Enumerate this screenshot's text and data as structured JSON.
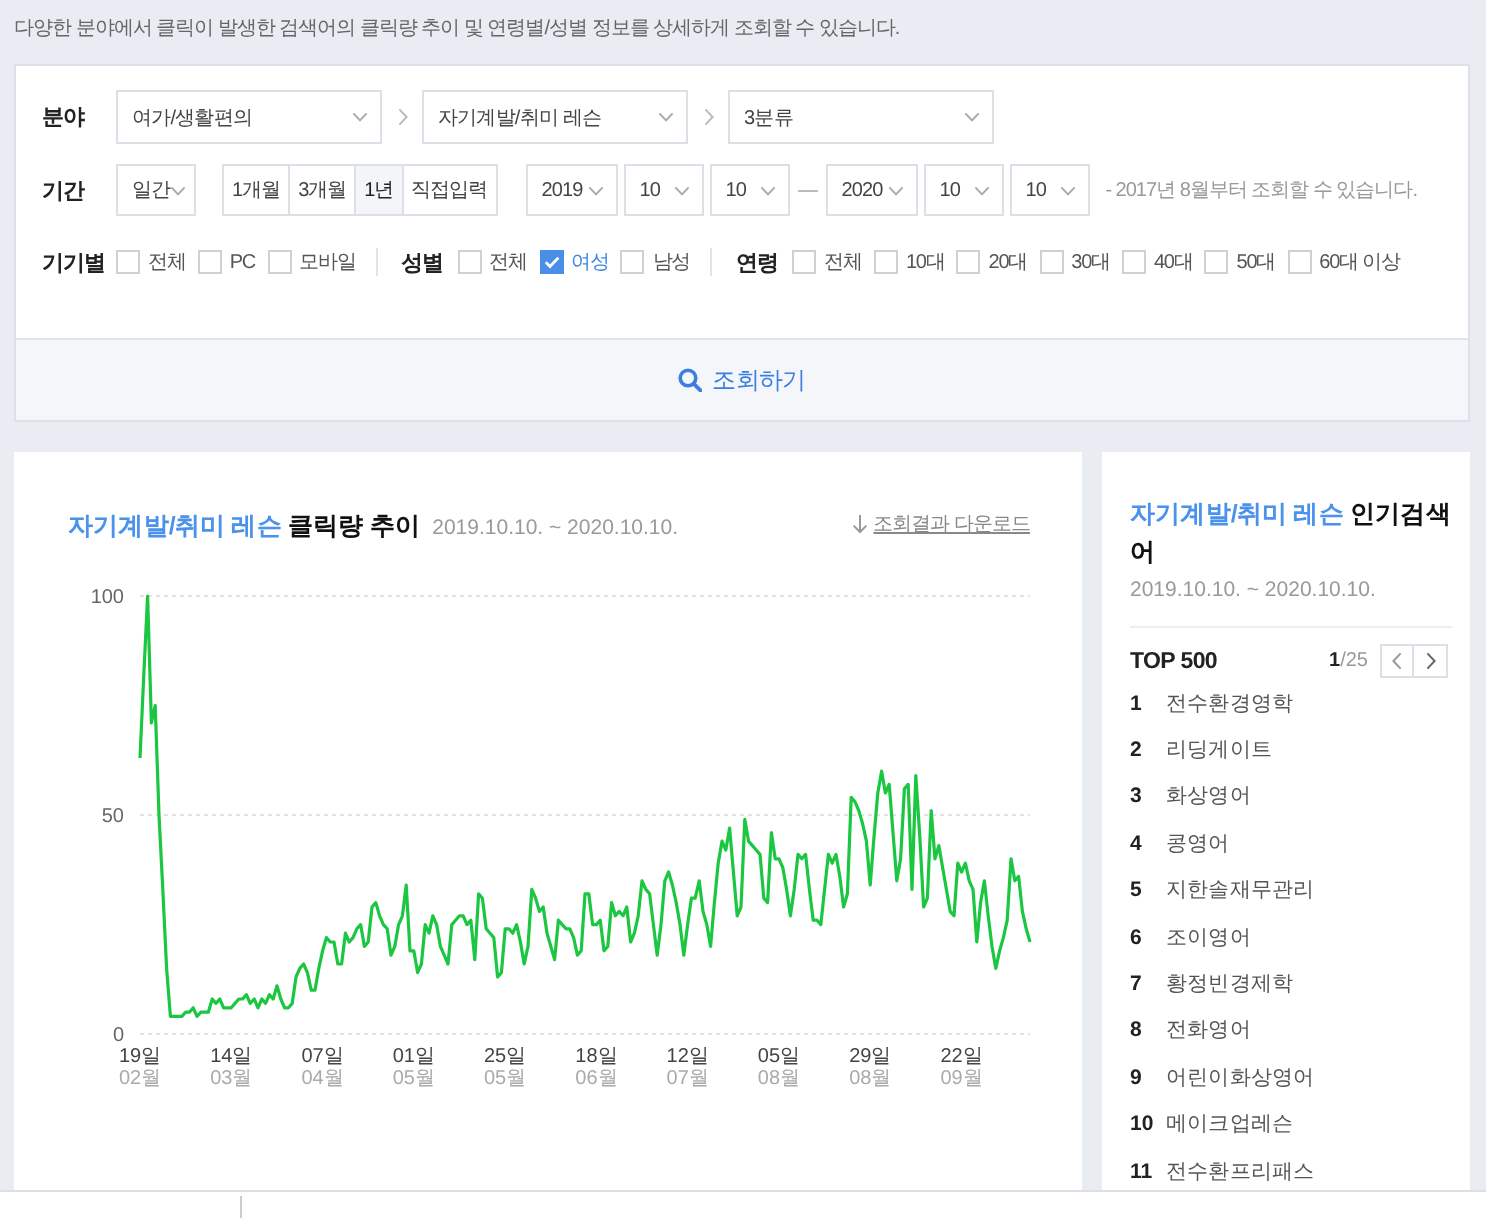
{
  "description": "다양한 분야에서 클릭이 발생한 검색어의 클릭량 추이 및 연령별/성별 정보를 상세하게 조회할 수 있습니다.",
  "filters": {
    "category": {
      "label": "분야",
      "levels": [
        "여가/생활편의",
        "자기계발/취미 레슨",
        "3분류"
      ]
    },
    "period": {
      "label": "기간",
      "unit": "일간",
      "ranges": [
        {
          "label": "1개월",
          "selected": false
        },
        {
          "label": "3개월",
          "selected": false
        },
        {
          "label": "1년",
          "selected": true
        },
        {
          "label": "직접입력",
          "selected": false
        }
      ],
      "start": {
        "year": "2019",
        "month": "10",
        "day": "10"
      },
      "end": {
        "year": "2020",
        "month": "10",
        "day": "10"
      },
      "note": "- 2017년 8월부터 조회할 수 있습니다."
    },
    "groups": [
      {
        "label": "기기별",
        "options": [
          {
            "label": "전체",
            "checked": false
          },
          {
            "label": "PC",
            "checked": false
          },
          {
            "label": "모바일",
            "checked": false
          }
        ]
      },
      {
        "label": "성별",
        "options": [
          {
            "label": "전체",
            "checked": false
          },
          {
            "label": "여성",
            "checked": true
          },
          {
            "label": "남성",
            "checked": false
          }
        ]
      },
      {
        "label": "연령",
        "options": [
          {
            "label": "전체",
            "checked": false
          },
          {
            "label": "10대",
            "checked": false
          },
          {
            "label": "20대",
            "checked": false
          },
          {
            "label": "30대",
            "checked": false
          },
          {
            "label": "40대",
            "checked": false
          },
          {
            "label": "50대",
            "checked": false
          },
          {
            "label": "60대 이상",
            "checked": false
          }
        ]
      }
    ],
    "search_button": "조회하기"
  },
  "trend": {
    "title_category": "자기계발/취미 레슨",
    "title": "클릭량 추이",
    "date_range": "2019.10.10. ~ 2020.10.10.",
    "download": "조회결과 다운로드",
    "chart_data": {
      "type": "line",
      "ylim": [
        0,
        100
      ],
      "yticks": [
        0,
        50,
        100
      ],
      "categories": [
        "19일 02월",
        null,
        null,
        null,
        null,
        null,
        null,
        null,
        null,
        null,
        null,
        null,
        null,
        null,
        null,
        null,
        null,
        null,
        null,
        null,
        null,
        null,
        null,
        null,
        "14일 03월",
        null,
        null,
        null,
        null,
        null,
        null,
        null,
        null,
        null,
        null,
        null,
        null,
        null,
        null,
        null,
        null,
        null,
        null,
        null,
        null,
        null,
        null,
        null,
        "07일 04월",
        null,
        null,
        null,
        null,
        null,
        null,
        null,
        null,
        null,
        null,
        null,
        null,
        null,
        null,
        null,
        null,
        null,
        null,
        null,
        null,
        null,
        null,
        null,
        "01일 05월",
        null,
        null,
        null,
        null,
        null,
        null,
        null,
        null,
        null,
        null,
        null,
        null,
        null,
        null,
        null,
        null,
        null,
        null,
        null,
        null,
        null,
        null,
        null,
        "25일 05월",
        null,
        null,
        null,
        null,
        null,
        null,
        null,
        null,
        null,
        null,
        null,
        null,
        null,
        null,
        null,
        null,
        null,
        null,
        null,
        null,
        null,
        null,
        null,
        "18일 06월",
        null,
        null,
        null,
        null,
        null,
        null,
        null,
        null,
        null,
        null,
        null,
        null,
        null,
        null,
        null,
        null,
        null,
        null,
        null,
        null,
        null,
        null,
        null,
        "12일 07월",
        null,
        null,
        null,
        null,
        null,
        null,
        null,
        null,
        null,
        null,
        null,
        null,
        null,
        null,
        null,
        null,
        null,
        null,
        null,
        null,
        null,
        null,
        null,
        "05일 08월",
        null,
        null,
        null,
        null,
        null,
        null,
        null,
        null,
        null,
        null,
        null,
        null,
        null,
        null,
        null,
        null,
        null,
        null,
        null,
        null,
        null,
        null,
        null,
        "29일 08월",
        null,
        null,
        null,
        null,
        null,
        null,
        null,
        null,
        null,
        null,
        null,
        null,
        null,
        null,
        null,
        null,
        null,
        null,
        null,
        null,
        null,
        null,
        null,
        "22일 09월",
        null,
        null,
        null,
        null,
        null,
        null,
        null,
        null,
        null,
        null,
        null,
        null,
        null,
        null,
        null,
        null,
        null,
        null
      ],
      "series": [
        {
          "color": "#1bc640",
          "values": [
            63,
            82,
            100,
            71,
            75,
            50,
            33,
            15,
            4,
            4,
            4,
            4,
            5,
            5,
            6,
            4,
            5,
            5,
            5,
            8,
            7,
            8,
            6,
            6,
            6,
            7,
            8,
            8,
            9,
            7,
            8,
            6,
            8,
            7,
            9,
            8,
            11,
            8,
            6,
            6,
            7,
            13,
            15,
            16,
            14,
            10,
            10,
            15,
            19,
            22,
            21,
            21,
            16,
            16,
            23,
            21,
            22,
            24,
            25,
            20,
            21,
            29,
            30,
            27,
            25,
            24,
            18,
            20,
            25,
            27,
            34,
            19,
            19,
            14,
            16,
            25,
            23,
            27,
            25,
            20,
            18,
            16,
            25,
            26,
            27,
            27,
            25,
            26,
            17,
            32,
            31,
            24,
            23,
            22,
            13,
            14,
            24,
            24,
            23,
            25,
            21,
            16,
            20,
            33,
            31,
            28,
            29,
            23,
            20,
            17,
            26,
            25,
            24,
            24,
            22,
            18,
            19,
            32,
            32,
            25,
            25,
            26,
            19,
            20,
            30,
            27,
            28,
            27,
            29,
            21,
            23,
            27,
            35,
            33,
            32,
            25,
            18,
            25,
            35,
            37,
            34,
            30,
            25,
            18,
            25,
            31,
            31,
            35,
            28,
            25,
            20,
            30,
            39,
            44,
            42,
            47,
            37,
            27,
            29,
            49,
            44,
            43,
            42,
            41,
            31,
            30,
            46,
            40,
            40,
            38,
            33,
            27,
            33,
            41,
            40,
            41,
            33,
            26,
            26,
            25,
            33,
            41,
            39,
            41,
            36,
            29,
            32,
            54,
            53,
            51,
            48,
            44,
            34,
            45,
            55,
            60,
            55,
            57,
            46,
            35,
            40,
            56,
            57,
            33,
            59,
            45,
            29,
            31,
            51,
            40,
            43,
            38,
            33,
            28,
            27,
            39,
            37,
            39,
            35,
            33,
            21,
            30,
            35,
            27,
            20,
            15,
            19,
            22,
            26,
            40,
            35,
            36,
            28,
            24,
            21
          ]
        }
      ]
    }
  },
  "ranking": {
    "title_category": "자기계발/취미 레슨",
    "title": "인기검색어",
    "date_range": "2019.10.10. ~ 2020.10.10.",
    "heading": "TOP 500",
    "page": "**1**/25",
    "items": [
      {
        "rank": "1",
        "term": "전수환경영학"
      },
      {
        "rank": "2",
        "term": "리딩게이트"
      },
      {
        "rank": "3",
        "term": "화상영어"
      },
      {
        "rank": "4",
        "term": "콩영어"
      },
      {
        "rank": "5",
        "term": "지한솔재무관리"
      },
      {
        "rank": "6",
        "term": "조이영어"
      },
      {
        "rank": "7",
        "term": "황정빈경제학"
      },
      {
        "rank": "8",
        "term": "전화영어"
      },
      {
        "rank": "9",
        "term": "어린이화상영어"
      },
      {
        "rank": "10",
        "term": "메이크업레슨"
      },
      {
        "rank": "11",
        "term": "전수환프리패스"
      }
    ]
  }
}
